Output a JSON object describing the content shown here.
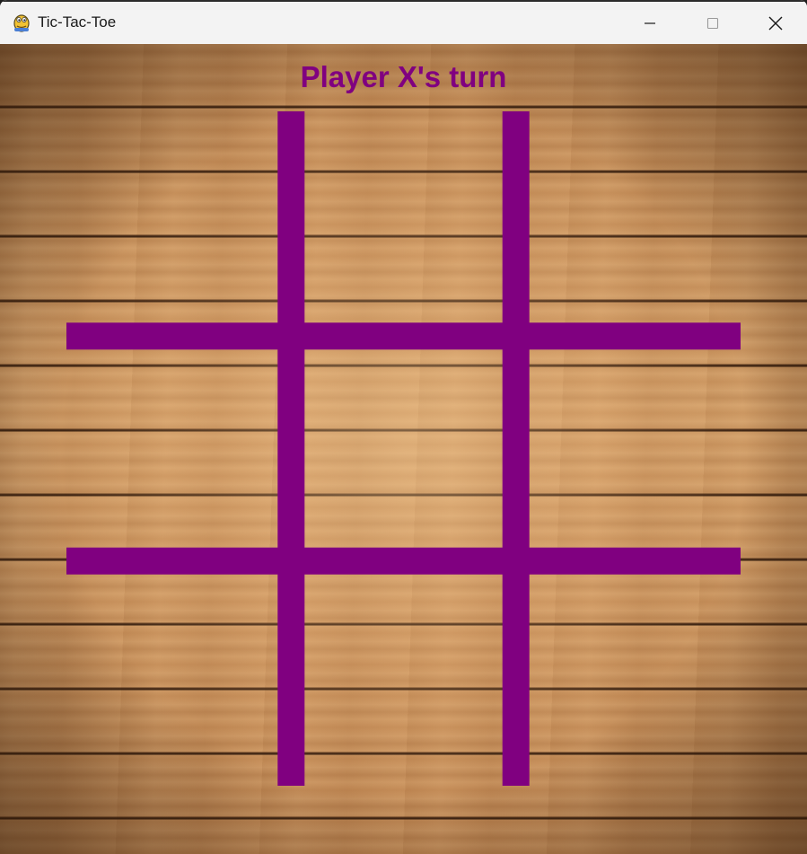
{
  "window": {
    "title": "Tic-Tac-Toe",
    "app_icon": "python-snake-icon",
    "controls": {
      "minimize_icon": "minimize-icon",
      "maximize_icon": "maximize-icon",
      "close_icon": "close-icon"
    }
  },
  "game": {
    "status_text": "Player X's turn",
    "current_player": "X",
    "grid_color": "#800080",
    "text_color": "#800080",
    "background": "wood-planks",
    "board": {
      "rows": 3,
      "cols": 3,
      "cells": [
        [
          "",
          "",
          ""
        ],
        [
          "",
          "",
          ""
        ],
        [
          "",
          "",
          ""
        ]
      ]
    }
  }
}
